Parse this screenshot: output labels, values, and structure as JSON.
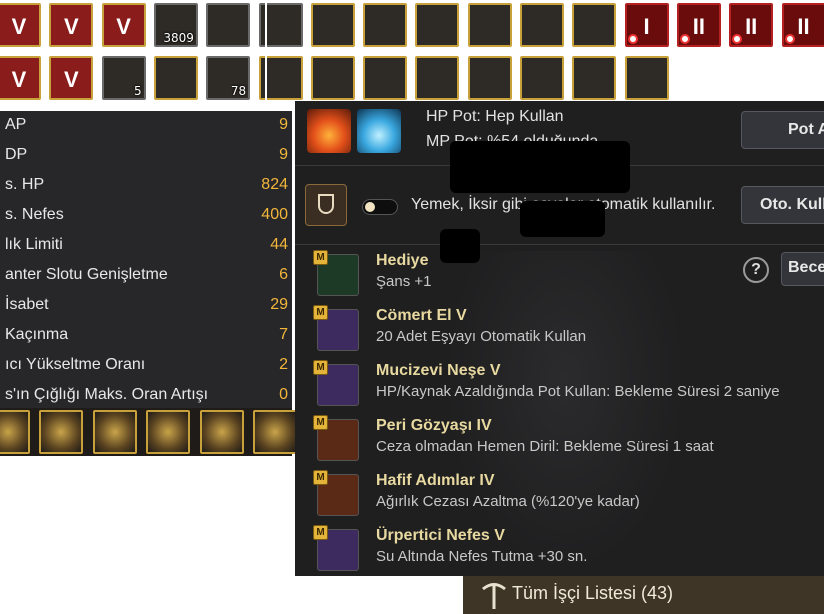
{
  "inventory_top": [
    {
      "name": "arrow-up-potion-icon",
      "glyph": "V",
      "border": "gold"
    },
    {
      "name": "arrow-up-potion-icon-2",
      "glyph": "V",
      "border": "gold"
    },
    {
      "name": "v-sword-scroll-icon",
      "glyph": "V",
      "border": "gold"
    },
    {
      "name": "crystal-sword-icon",
      "glyph": "",
      "count": "3809",
      "border": "grey"
    },
    {
      "name": "empty-slot-icon",
      "glyph": "",
      "border": "grey"
    },
    {
      "name": "hammer-icon",
      "glyph": "",
      "border": "grey"
    },
    {
      "name": "high-heel-shoe-icon",
      "glyph": "",
      "border": "gold"
    },
    {
      "name": "skull-medal-icon",
      "glyph": "",
      "border": "gold"
    },
    {
      "name": "treasure-chest-icon",
      "glyph": "",
      "border": "gold"
    },
    {
      "name": "purple-gift-box-icon",
      "glyph": "",
      "border": "gold"
    },
    {
      "name": "purple-gift-box-icon-2",
      "glyph": "",
      "border": "gold"
    },
    {
      "name": "horn-icon",
      "glyph": "",
      "border": "gold"
    },
    {
      "name": "red-scroll-i-icon",
      "glyph": "I",
      "border": "red"
    },
    {
      "name": "red-scroll-ii-icon",
      "glyph": "II",
      "border": "red"
    },
    {
      "name": "red-scroll-ii-icon-2",
      "glyph": "II",
      "border": "red"
    },
    {
      "name": "red-scroll-ii-icon-3",
      "glyph": "II",
      "border": "red"
    }
  ],
  "inventory_second": [
    {
      "name": "red-v-orb-icon",
      "glyph": "V",
      "border": "gold"
    },
    {
      "name": "red-v-gem-icon",
      "glyph": "V",
      "border": "gold"
    },
    {
      "name": "silver-orb-icon",
      "glyph": "",
      "count": "5",
      "border": "grey"
    },
    {
      "name": "green-herb-icon",
      "glyph": "",
      "border": "gold"
    },
    {
      "name": "white-ore-icon",
      "glyph": "",
      "count": "78",
      "border": "grey"
    },
    {
      "name": "box-icon",
      "glyph": "",
      "border": "gold"
    },
    {
      "name": "box-icon-2",
      "glyph": "",
      "border": "gold"
    },
    {
      "name": "box-icon-3",
      "glyph": "",
      "border": "gold"
    },
    {
      "name": "box-icon-4",
      "glyph": "",
      "border": "gold"
    },
    {
      "name": "box-icon-5",
      "glyph": "",
      "border": "gold"
    },
    {
      "name": "box-icon-6",
      "glyph": "",
      "border": "gold"
    },
    {
      "name": "box-icon-7",
      "glyph": "",
      "border": "gold"
    },
    {
      "name": "box-icon-8",
      "glyph": "",
      "border": "gold"
    }
  ],
  "stats": [
    {
      "label": "AP",
      "value": "9"
    },
    {
      "label": "DP",
      "value": "9"
    },
    {
      "label": "s. HP",
      "value": "824"
    },
    {
      "label": "s. Nefes",
      "value": "400"
    },
    {
      "label": "lık Limiti",
      "value": "44"
    },
    {
      "label": "anter Slotu Genişletme",
      "value": "6"
    },
    {
      "label": " İsabet",
      "value": "29"
    },
    {
      "label": " Kaçınma",
      "value": "7"
    },
    {
      "label": "ıcı Yükseltme Oranı",
      "value": "2"
    },
    {
      "label": "s'ın Çığlığı Maks. Oran Artışı",
      "value": "0"
    }
  ],
  "bottom_slots_count": 6,
  "pot": {
    "hp_text": "HP Pot: Hep Kullan",
    "mp_text": "MP Pot: %54 olduğunda",
    "button_label": "Pot A"
  },
  "auto_use": {
    "text": "Yemek, İksir gibi eşyalar otomatik kullanılır.",
    "button_label": "Oto. Kull",
    "toggle_on": false
  },
  "help_icon_text": "?",
  "partial_button_label": "Bece",
  "skills": [
    {
      "name": "Hediye",
      "desc": "Şans +1",
      "icon": "clover-icon",
      "color": "#1d3a26"
    },
    {
      "name": "Cömert El V",
      "desc": "20 Adet Eşyayı Otomatik Kullan",
      "icon": "fairy-icon",
      "color": "#3d2a5e"
    },
    {
      "name": "Mucizevi Neşe V",
      "desc": "HP/Kaynak Azaldığında Pot Kullan: Bekleme Süresi 2 saniye",
      "icon": "potion-plus-icon",
      "color": "#3d2a5e"
    },
    {
      "name": "Peri Gözyaşı IV",
      "desc": "Ceza olmadan Hemen Diril: Bekleme Süresi 1 saat",
      "icon": "tear-vial-icon",
      "color": "#5a2a16"
    },
    {
      "name": "Hafif Adımlar IV",
      "desc": "Ağırlık Cezası Azaltma (%120'ye kadar)",
      "icon": "weight-icon",
      "color": "#5a2a16"
    },
    {
      "name": "Ürpertici Nefes V",
      "desc": "Su Altında Nefes Tutma +30 sn.",
      "icon": "bubble-clock-icon",
      "color": "#3d2a5e"
    }
  ],
  "worker_list_label": "Tüm İşçi Listesi (43)"
}
